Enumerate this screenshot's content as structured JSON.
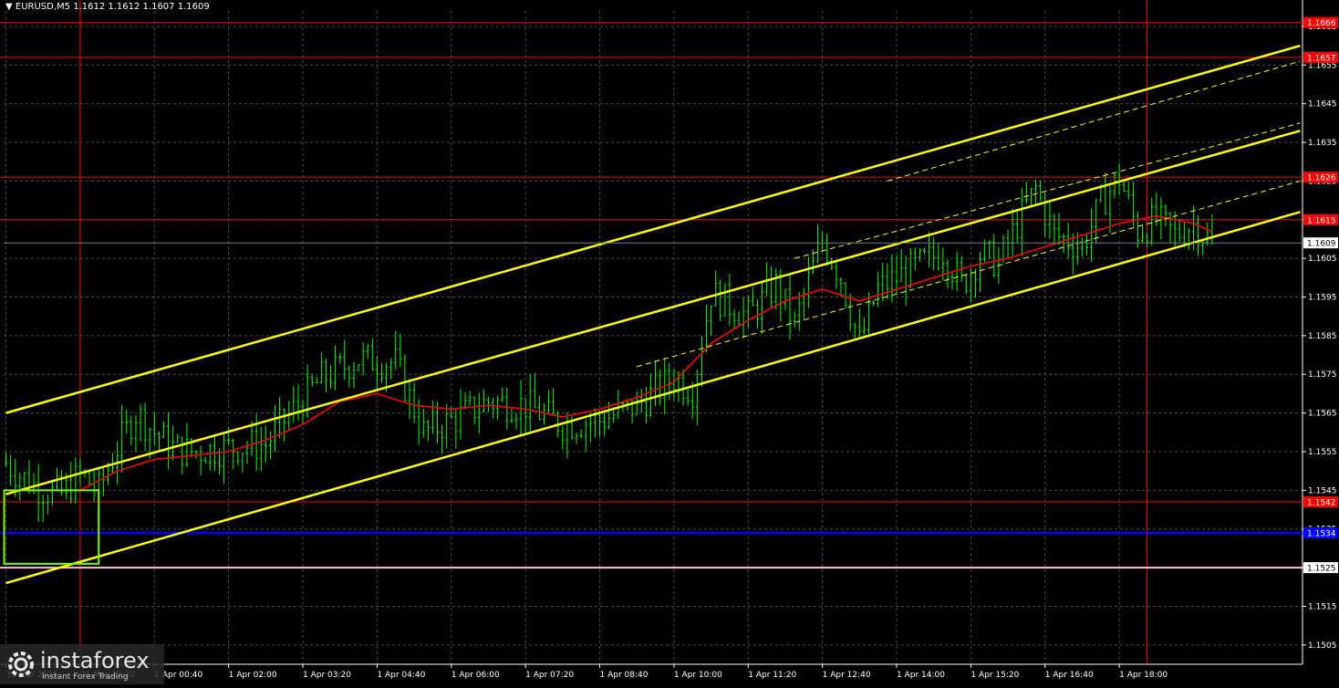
{
  "header": {
    "symbol": "EURUSD,M5",
    "ohlc": "1.1612 1.1612 1.1607 1.1609"
  },
  "watermark": {
    "brand": "instaforex",
    "tagline": "Instant Forex Trading"
  },
  "colors": {
    "background": "#000000",
    "candle": "#00ff00",
    "grid": "#4a4a4a",
    "axis_text": "#ffffff",
    "resistance": "#ff0000",
    "channel": "#ffff00",
    "ma": "#ff0000",
    "blue_level": "#0000ff",
    "pink_level": "#ffc0cb",
    "box": "#7cfc00"
  },
  "chart_data": {
    "type": "candlestick",
    "symbol": "EURUSD",
    "timeframe": "M5",
    "ylim": [
      1.15,
      1.1669
    ],
    "y_ticks": [
      "1.1505",
      "1.1515",
      "1.1525",
      "1.1535",
      "1.1545",
      "1.1555",
      "1.1565",
      "1.1575",
      "1.1585",
      "1.1595",
      "1.1605",
      "1.1615",
      "1.1625",
      "1.1635",
      "1.1645",
      "1.1655",
      "1.1665"
    ],
    "x_ticks": [
      "31 Mar 2025",
      "31 Mar 23:20",
      "1 Apr 00:40",
      "1 Apr 02:00",
      "1 Apr 03:20",
      "1 Apr 04:40",
      "1 Apr 06:00",
      "1 Apr 07:20",
      "1 Apr 08:40",
      "1 Apr 10:00",
      "1 Apr 11:20",
      "1 Apr 12:40",
      "1 Apr 14:00",
      "1 Apr 15:20",
      "1 Apr 16:40",
      "1 Apr 18:00"
    ],
    "x_tick_index": [
      0,
      16,
      32,
      48,
      64,
      80,
      96,
      112,
      128,
      144,
      160,
      176,
      192,
      208,
      224,
      240
    ],
    "bar_count": 264,
    "price_path": [
      [
        0,
        1.1552
      ],
      [
        4,
        1.1548
      ],
      [
        8,
        1.1545
      ],
      [
        12,
        1.1544
      ],
      [
        16,
        1.1549
      ],
      [
        20,
        1.1545
      ],
      [
        24,
        1.1556
      ],
      [
        28,
        1.1565
      ],
      [
        32,
        1.156
      ],
      [
        36,
        1.1556
      ],
      [
        40,
        1.1555
      ],
      [
        48,
        1.1556
      ],
      [
        56,
        1.1557
      ],
      [
        60,
        1.1563
      ],
      [
        68,
        1.1574
      ],
      [
        76,
        1.1579
      ],
      [
        84,
        1.1578
      ],
      [
        90,
        1.156
      ],
      [
        96,
        1.1563
      ],
      [
        104,
        1.1568
      ],
      [
        112,
        1.1567
      ],
      [
        120,
        1.1562
      ],
      [
        128,
        1.1563
      ],
      [
        136,
        1.1567
      ],
      [
        144,
        1.1574
      ],
      [
        148,
        1.1571
      ],
      [
        152,
        1.1596
      ],
      [
        160,
        1.159
      ],
      [
        166,
        1.1598
      ],
      [
        170,
        1.1588
      ],
      [
        176,
        1.161
      ],
      [
        180,
        1.16
      ],
      [
        184,
        1.1583
      ],
      [
        188,
        1.1597
      ],
      [
        192,
        1.16
      ],
      [
        198,
        1.1604
      ],
      [
        202,
        1.1607
      ],
      [
        206,
        1.1598
      ],
      [
        210,
        1.1606
      ],
      [
        214,
        1.1604
      ],
      [
        218,
        1.1614
      ],
      [
        222,
        1.1623
      ],
      [
        226,
        1.1611
      ],
      [
        232,
        1.1608
      ],
      [
        236,
        1.1619
      ],
      [
        240,
        1.1626
      ],
      [
        244,
        1.1612
      ],
      [
        248,
        1.1615
      ],
      [
        252,
        1.1611
      ],
      [
        256,
        1.1614
      ],
      [
        260,
        1.1609
      ]
    ],
    "moving_average": [
      [
        16,
        1.1545
      ],
      [
        24,
        1.155
      ],
      [
        32,
        1.1553
      ],
      [
        40,
        1.1554
      ],
      [
        48,
        1.1555
      ],
      [
        56,
        1.1558
      ],
      [
        64,
        1.1562
      ],
      [
        72,
        1.1568
      ],
      [
        80,
        1.157
      ],
      [
        88,
        1.1567
      ],
      [
        96,
        1.1566
      ],
      [
        104,
        1.1567
      ],
      [
        112,
        1.1566
      ],
      [
        120,
        1.1564
      ],
      [
        128,
        1.1566
      ],
      [
        136,
        1.1569
      ],
      [
        144,
        1.1573
      ],
      [
        152,
        1.1583
      ],
      [
        160,
        1.1589
      ],
      [
        168,
        1.1594
      ],
      [
        176,
        1.1597
      ],
      [
        184,
        1.1594
      ],
      [
        192,
        1.1597
      ],
      [
        200,
        1.16
      ],
      [
        208,
        1.1603
      ],
      [
        216,
        1.1605
      ],
      [
        224,
        1.1608
      ],
      [
        232,
        1.1611
      ],
      [
        240,
        1.1614
      ],
      [
        248,
        1.1616
      ],
      [
        256,
        1.1614
      ],
      [
        260,
        1.1612
      ]
    ],
    "horizontal_levels": [
      {
        "price": 1.1666,
        "label": "1.1666",
        "kind": "resistance"
      },
      {
        "price": 1.1657,
        "label": "1.1657",
        "kind": "resistance"
      },
      {
        "price": 1.1626,
        "label": "1.1626",
        "kind": "resistance"
      },
      {
        "price": 1.1615,
        "label": "1.1615",
        "kind": "resistance"
      },
      {
        "price": 1.1542,
        "label": "1.1542",
        "kind": "resistance"
      },
      {
        "price": 1.1534,
        "label": "1.1534",
        "kind": "blue"
      },
      {
        "price": 1.1525,
        "label": "1.1525",
        "kind": "pink"
      }
    ],
    "current_price": {
      "price": 1.1609,
      "label": "1.1609"
    },
    "vertical_lines": [
      16,
      246
    ],
    "channel_lines": [
      {
        "from": [
          0,
          1.1565
        ],
        "to": [
          279,
          1.166
        ],
        "style": "solid"
      },
      {
        "from": [
          0,
          1.1544
        ],
        "to": [
          279,
          1.1638
        ],
        "style": "solid"
      },
      {
        "from": [
          0,
          1.1521
        ],
        "to": [
          279,
          1.1617
        ],
        "style": "solid"
      },
      {
        "from": [
          190,
          1.1625
        ],
        "to": [
          279,
          1.1656
        ],
        "style": "dashed"
      },
      {
        "from": [
          170,
          1.1605
        ],
        "to": [
          279,
          1.164
        ],
        "style": "dashed"
      },
      {
        "from": [
          136,
          1.1577
        ],
        "to": [
          279,
          1.1625
        ],
        "style": "dashed"
      }
    ],
    "box": {
      "x0": 0,
      "x1": 20,
      "y0": 1.1545,
      "y1": 1.1526
    },
    "grid": true
  }
}
